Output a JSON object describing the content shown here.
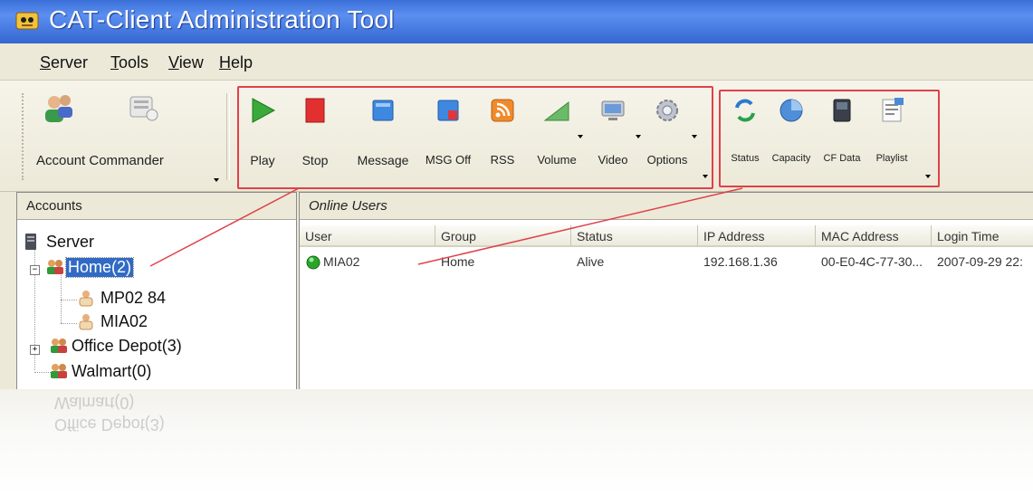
{
  "window": {
    "title": "CAT-Client Administration Tool"
  },
  "menu": [
    {
      "label": "Server",
      "ul": "S",
      "rest": "erver"
    },
    {
      "label": "Tools",
      "ul": "T",
      "rest": "ools"
    },
    {
      "label": "View",
      "ul": "V",
      "rest": "iew"
    },
    {
      "label": "Help",
      "ul": "H",
      "rest": "elp"
    }
  ],
  "toolbar": {
    "account": "Account",
    "commander": "Commander",
    "play": "Play",
    "stop": "Stop",
    "message": "Message",
    "msg_off": "MSG Off",
    "rss": "RSS",
    "volume": "Volume",
    "video": "Video",
    "options": "Options",
    "status": "Status",
    "capacity": "Capacity",
    "cf_data": "CF Data",
    "playlist": "Playlist"
  },
  "accounts": {
    "header": "Accounts",
    "server": "Server",
    "home": "Home(2)",
    "mp02": "MP02 84",
    "mia02": "MIA02",
    "office_depot": "Office Depot(3)",
    "walmart": "Walmart(0)"
  },
  "online_users": {
    "header": "Online Users",
    "columns": {
      "user": "User",
      "group": "Group",
      "status": "Status",
      "ip": "IP Address",
      "mac": "MAC Address",
      "login": "Login Time"
    },
    "rows": [
      {
        "user": "MIA02",
        "group": "Home",
        "status": "Alive",
        "ip": "192.168.1.36",
        "mac": "00-E0-4C-77-30...",
        "login": "2007-09-29 22:"
      }
    ]
  },
  "reflection": {
    "walmart": "Walmart(0)",
    "office_depot": "Office Depot(3)"
  },
  "colors": {
    "title_bar": "#3a6fd8",
    "highlight_box": "#e0404a",
    "selection": "#316ac5",
    "online_status": "#2aa52a"
  }
}
